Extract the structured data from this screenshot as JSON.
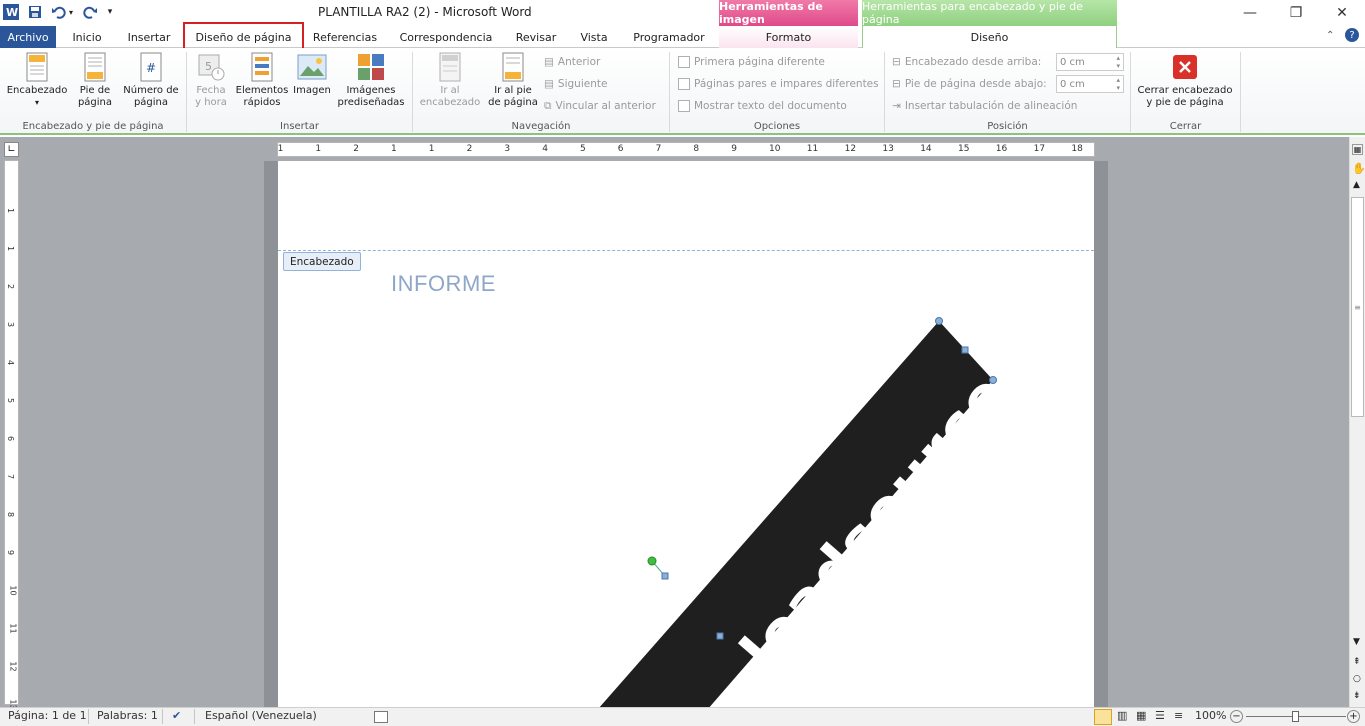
{
  "window": {
    "title": "PLANTILLA RA2 (2)  -  Microsoft Word",
    "context_image_tools": "Herramientas de imagen",
    "context_header_tools": "Herramientas para encabezado y pie de página"
  },
  "tabs": [
    {
      "label": "Archivo"
    },
    {
      "label": "Inicio"
    },
    {
      "label": "Insertar"
    },
    {
      "label": "Diseño de página"
    },
    {
      "label": "Referencias"
    },
    {
      "label": "Correspondencia"
    },
    {
      "label": "Revisar"
    },
    {
      "label": "Vista"
    },
    {
      "label": "Programador"
    },
    {
      "label": "Formato"
    },
    {
      "label": "Diseño"
    }
  ],
  "ribbon": {
    "groups": {
      "header_footer": "Encabezado y pie de página",
      "insert": "Insertar",
      "navigation": "Navegación",
      "options": "Opciones",
      "position": "Posición",
      "close": "Cerrar"
    },
    "buttons": {
      "header_1": "Encabezado",
      "footer_1": "Pie de",
      "footer_2": "página",
      "pagenum_1": "Número de",
      "pagenum_2": "página",
      "date_1": "Fecha",
      "date_2": "y hora",
      "quick_1": "Elementos",
      "quick_2": "rápidos",
      "image": "Imagen",
      "clipart_1": "Imágenes",
      "clipart_2": "prediseñadas",
      "goto_header_1": "Ir al",
      "goto_header_2": "encabezado",
      "goto_footer_1": "Ir al pie",
      "goto_footer_2": "de página",
      "previous": "Anterior",
      "next": "Siguiente",
      "link_previous": "Vincular al anterior",
      "close_1": "Cerrar encabezado",
      "close_2": "y pie de página"
    },
    "options": {
      "first_page": "Primera página diferente",
      "odd_even": "Páginas pares e impares diferentes",
      "show_text": "Mostrar texto del documento"
    },
    "position": {
      "header_top_label": "Encabezado desde arriba:",
      "header_top_value": "0 cm",
      "footer_bottom_label": "Pie de página desde abajo:",
      "footer_bottom_value": "0 cm",
      "insert_tab": "Insertar tabulación de alineación"
    }
  },
  "ruler": {
    "h_ticks": [
      "1",
      "1",
      "2",
      "1",
      "1",
      "2",
      "3",
      "4",
      "5",
      "6",
      "7",
      "8",
      "9",
      "10",
      "11",
      "12",
      "13",
      "14",
      "15",
      "16",
      "17",
      "18"
    ],
    "v_ticks": [
      "1",
      "1",
      "2",
      "3",
      "4",
      "5",
      "6",
      "7",
      "8",
      "9",
      "10",
      "11",
      "12",
      "13"
    ]
  },
  "document": {
    "header_tag": "Encabezado",
    "heading": "INFORME",
    "watermark_text": "loadsource"
  },
  "status": {
    "page": "Página: 1 de 1",
    "words": "Palabras: 1",
    "language": "Español (Venezuela)",
    "zoom": "100%"
  },
  "colors": {
    "accent": "#2b579a",
    "context_image": "#e04a8a",
    "context_header": "#8fd080",
    "highlight_box": "#d42222"
  }
}
